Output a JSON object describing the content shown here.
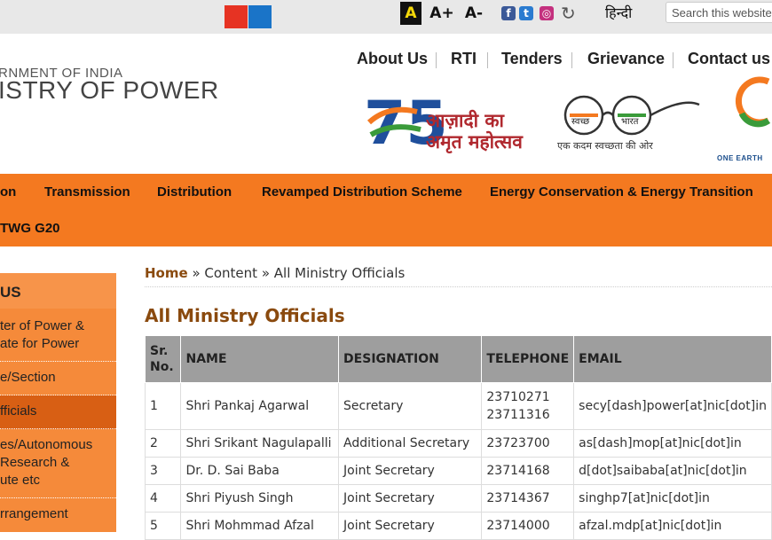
{
  "topbar": {
    "font_normal": "A",
    "font_increase": "A+",
    "font_decrease": "A-",
    "language": "हिन्दी",
    "search_placeholder": "Search this website...",
    "social": [
      "f",
      "t",
      "◎"
    ]
  },
  "logo": {
    "line1": "RNMENT OF INDIA",
    "line2": "ISTRY OF POWER"
  },
  "top_nav": [
    "About Us",
    "RTI",
    "Tenders",
    "Grievance",
    "Contact us"
  ],
  "banners": {
    "azadi_number": "75",
    "azadi_line1": "आज़ादी का",
    "azadi_line2": "अमृत महोत्सव",
    "swachh_left": "स्वच्छ",
    "swachh_right": "भारत",
    "swachh_tagline": "एक कदम स्वच्छता की ओर",
    "g20_tagline": "ONE EARTH"
  },
  "main_nav": {
    "row1": [
      "on",
      "Transmission",
      "Distribution",
      "Revamped Distribution Scheme",
      "Energy Conservation & Energy Transition"
    ],
    "row2": [
      "TWG G20"
    ]
  },
  "sidebar": {
    "heading": "US",
    "items": [
      {
        "lines": [
          "ter of Power &",
          "ate for Power"
        ]
      },
      {
        "lines": [
          "e/Section"
        ]
      },
      {
        "lines": [
          "fficials"
        ],
        "active": true
      },
      {
        "lines": [
          "es/Autonomous",
          "Research &",
          "ute etc"
        ]
      },
      {
        "lines": [
          "rrangement"
        ]
      }
    ]
  },
  "breadcrumb": {
    "home": "Home",
    "separator1": " » ",
    "content": "Content",
    "separator2": " » ",
    "current": "All Ministry Officials"
  },
  "page_title": "All Ministry Officials",
  "table": {
    "headers": [
      "Sr. No.",
      "NAME",
      "DESIGNATION",
      "TELEPHONE",
      "EMAIL"
    ],
    "rows": [
      {
        "sr": "1",
        "name": "Shri Pankaj Agarwal",
        "designation": "Secretary",
        "telephone": [
          "23710271",
          "23711316"
        ],
        "email": "secy[dash]power[at]nic[dot]in"
      },
      {
        "sr": "2",
        "name": "Shri Srikant Nagulapalli",
        "designation": "Additional Secretary",
        "telephone": [
          "23723700"
        ],
        "email": "as[dash]mop[at]nic[dot]in"
      },
      {
        "sr": "3",
        "name": "Dr. D. Sai Baba",
        "designation": "Joint Secretary",
        "telephone": [
          "23714168"
        ],
        "email": "d[dot]saibaba[at]nic[dot]in"
      },
      {
        "sr": "4",
        "name": "Shri Piyush Singh",
        "designation": "Joint Secretary",
        "telephone": [
          "23714367"
        ],
        "email": "singhp7[at]nic[dot]in"
      },
      {
        "sr": "5",
        "name": "Shri Mohmmad Afzal",
        "designation": "Joint Secretary",
        "telephone": [
          "23714000"
        ],
        "email": "afzal.mdp[at]nic[dot]in"
      }
    ]
  },
  "colors": {
    "orange_nav": "#f47920",
    "sidebar_orange": "#f58a3a",
    "sidebar_active": "#d85f14",
    "title_brown": "#8a4a0e",
    "table_header": "#9e9e9e"
  }
}
